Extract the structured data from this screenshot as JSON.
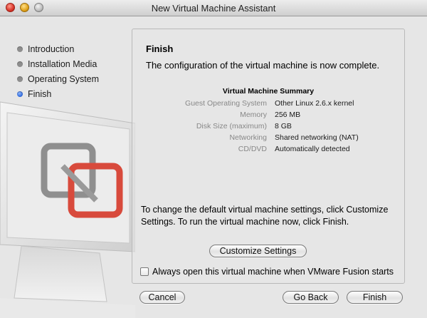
{
  "window": {
    "title": "New Virtual Machine Assistant"
  },
  "sidebar": {
    "steps": [
      {
        "label": "Introduction",
        "active": false
      },
      {
        "label": "Installation Media",
        "active": false
      },
      {
        "label": "Operating System",
        "active": false
      },
      {
        "label": "Finish",
        "active": true
      }
    ]
  },
  "main": {
    "heading": "Finish",
    "subtitle": "The configuration of the virtual machine is now complete.",
    "summary": {
      "title": "Virtual Machine Summary",
      "rows": [
        {
          "key": "Guest Operating System",
          "value": "Other Linux 2.6.x kernel"
        },
        {
          "key": "Memory",
          "value": "256 MB"
        },
        {
          "key": "Disk Size (maximum)",
          "value": "8 GB"
        },
        {
          "key": "Networking",
          "value": "Shared networking (NAT)"
        },
        {
          "key": "CD/DVD",
          "value": "Automatically detected"
        }
      ]
    },
    "customize_text": "To change the default virtual machine settings, click Customize Settings. To run the virtual machine now, click Finish.",
    "customize_button": "Customize Settings",
    "checkbox_label": "Always open this virtual machine when VMware Fusion starts",
    "checkbox_checked": false
  },
  "footer": {
    "cancel": "Cancel",
    "go_back": "Go Back",
    "finish": "Finish"
  },
  "colors": {
    "active_step": "#2a64d8",
    "inactive_step": "#8e8e8e"
  }
}
